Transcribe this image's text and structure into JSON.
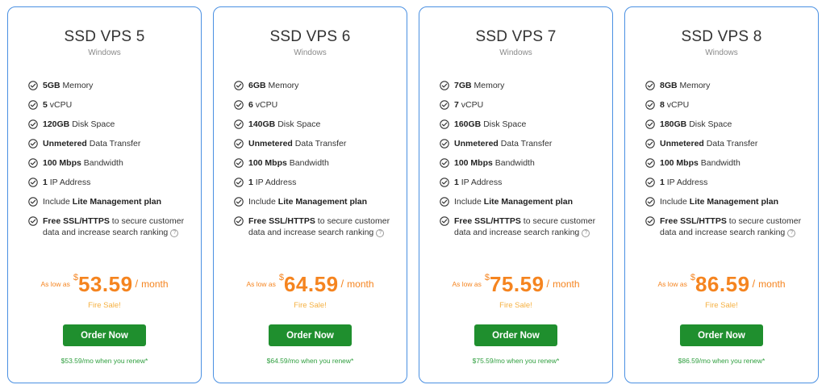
{
  "plans": [
    {
      "name": "SSD VPS 5",
      "os": "Windows",
      "features": [
        {
          "bold": "5GB",
          "text": " Memory"
        },
        {
          "bold": "5",
          "text": " vCPU"
        },
        {
          "bold": "120GB",
          "text": " Disk Space"
        },
        {
          "bold": "Unmetered",
          "text": " Data Transfer"
        },
        {
          "bold": "100 Mbps",
          "text": " Bandwidth"
        },
        {
          "bold": "1",
          "text": " IP Address"
        },
        {
          "pre": "Include ",
          "bold": "Lite Management plan",
          "text": ""
        },
        {
          "bold": "Free SSL/HTTPS",
          "text": " to secure customer data and increase search ranking"
        }
      ],
      "as_low_as": "As low as",
      "currency": "$",
      "price": "53.59",
      "slash": "/",
      "period": "month",
      "sale": "Fire Sale!",
      "order_label": "Order Now",
      "renew": "$53.59/mo when you renew*"
    },
    {
      "name": "SSD VPS 6",
      "os": "Windows",
      "features": [
        {
          "bold": "6GB",
          "text": " Memory"
        },
        {
          "bold": "6",
          "text": " vCPU"
        },
        {
          "bold": "140GB",
          "text": " Disk Space"
        },
        {
          "bold": "Unmetered",
          "text": " Data Transfer"
        },
        {
          "bold": "100 Mbps",
          "text": " Bandwidth"
        },
        {
          "bold": "1",
          "text": " IP Address"
        },
        {
          "pre": "Include ",
          "bold": "Lite Management plan",
          "text": ""
        },
        {
          "bold": "Free SSL/HTTPS",
          "text": " to secure customer data and increase search ranking"
        }
      ],
      "as_low_as": "As low as",
      "currency": "$",
      "price": "64.59",
      "slash": "/",
      "period": "month",
      "sale": "Fire Sale!",
      "order_label": "Order Now",
      "renew": "$64.59/mo when you renew*"
    },
    {
      "name": "SSD VPS 7",
      "os": "Windows",
      "features": [
        {
          "bold": "7GB",
          "text": " Memory"
        },
        {
          "bold": "7",
          "text": " vCPU"
        },
        {
          "bold": "160GB",
          "text": " Disk Space"
        },
        {
          "bold": "Unmetered",
          "text": " Data Transfer"
        },
        {
          "bold": "100 Mbps",
          "text": " Bandwidth"
        },
        {
          "bold": "1",
          "text": " IP Address"
        },
        {
          "pre": "Include ",
          "bold": "Lite Management plan",
          "text": ""
        },
        {
          "bold": "Free SSL/HTTPS",
          "text": " to secure customer data and increase search ranking"
        }
      ],
      "as_low_as": "As low as",
      "currency": "$",
      "price": "75.59",
      "slash": "/",
      "period": "month",
      "sale": "Fire Sale!",
      "order_label": "Order Now",
      "renew": "$75.59/mo when you renew*"
    },
    {
      "name": "SSD VPS 8",
      "os": "Windows",
      "features": [
        {
          "bold": "8GB",
          "text": " Memory"
        },
        {
          "bold": "8",
          "text": " vCPU"
        },
        {
          "bold": "180GB",
          "text": " Disk Space"
        },
        {
          "bold": "Unmetered",
          "text": " Data Transfer"
        },
        {
          "bold": "100 Mbps",
          "text": " Bandwidth"
        },
        {
          "bold": "1",
          "text": " IP Address"
        },
        {
          "pre": "Include ",
          "bold": "Lite Management plan",
          "text": ""
        },
        {
          "bold": "Free SSL/HTTPS",
          "text": " to secure customer data and increase search ranking"
        }
      ],
      "as_low_as": "As low as",
      "currency": "$",
      "price": "86.59",
      "slash": "/",
      "period": "month",
      "sale": "Fire Sale!",
      "order_label": "Order Now",
      "renew": "$86.59/mo when you renew*"
    }
  ],
  "icons": {
    "check": "check-circle-icon",
    "help": "question-circle-icon",
    "help_glyph": "?"
  },
  "colors": {
    "card_border": "#4a90e2",
    "price": "#f5841f",
    "sale": "#f5b041",
    "order_button": "#1f8f2e",
    "renew_text": "#2e9e3e"
  }
}
